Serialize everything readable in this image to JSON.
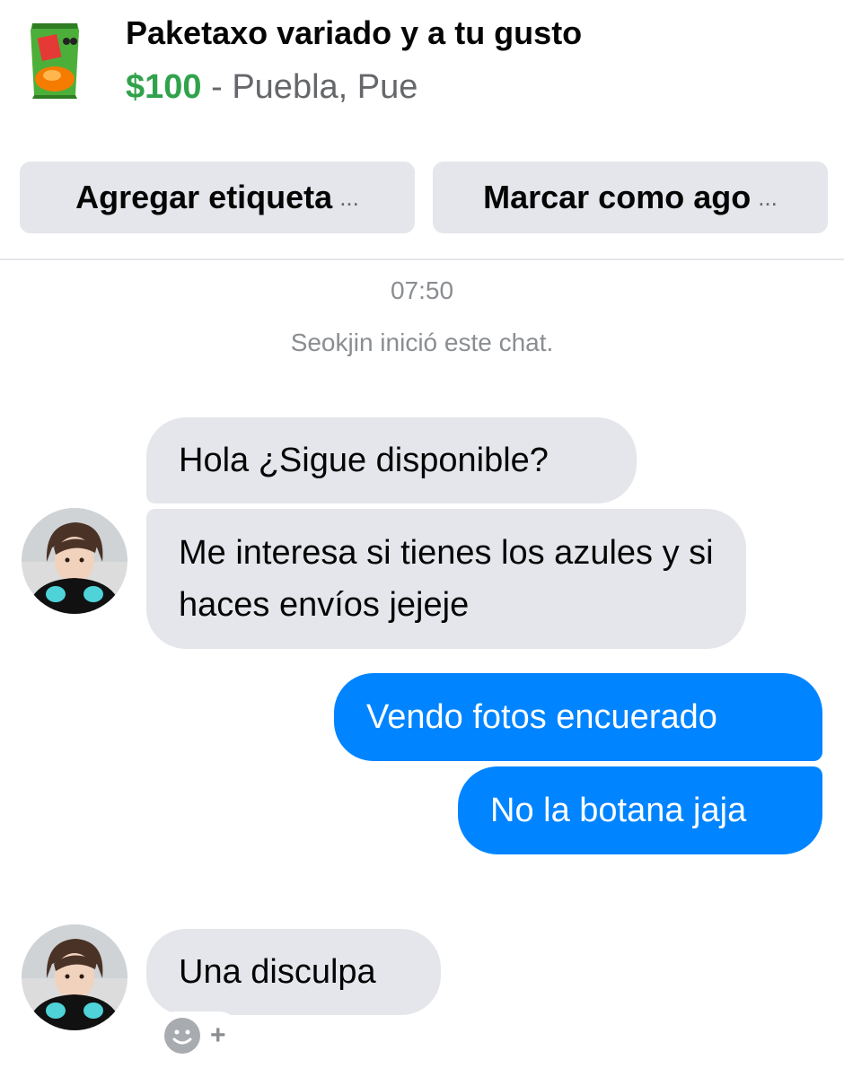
{
  "product": {
    "title": "Paketaxo variado y a tu gusto",
    "price": "$100",
    "separator": " - ",
    "location": "Puebla, Pue",
    "thumbnail_icon": "snack-bag-thumbnail"
  },
  "actions": {
    "tag_label": "Agregar etiqueta",
    "mark_label": "Marcar como ago",
    "ellipsis": "..."
  },
  "chat": {
    "timestamp": "07:50",
    "system_message": "Seokjin inició este chat.",
    "messages": [
      {
        "sender": "them",
        "text": "Hola ¿Sigue disponible?"
      },
      {
        "sender": "them",
        "text": "Me interesa si tienes los azules y si haces envíos jejeje"
      },
      {
        "sender": "me",
        "text": "Vendo fotos encuerado"
      },
      {
        "sender": "me",
        "text": "No la botana jaja"
      },
      {
        "sender": "them",
        "text": "Una disculpa"
      }
    ],
    "reaction_plus": "+"
  },
  "colors": {
    "price_green": "#31a24c",
    "outgoing_blue": "#0084ff",
    "incoming_gray": "#e4e6eb",
    "meta_gray": "#8a8d91"
  }
}
